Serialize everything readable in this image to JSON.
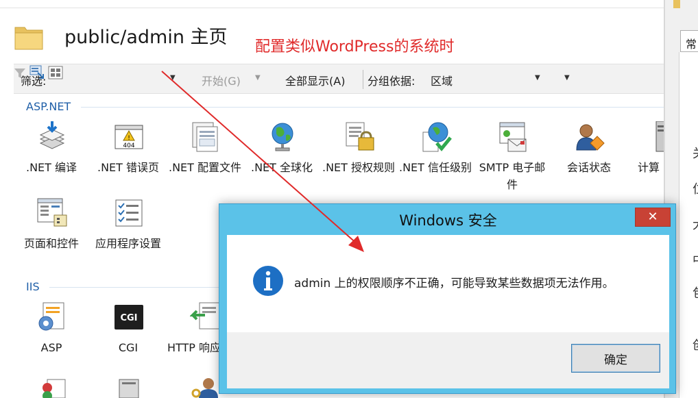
{
  "colors": {
    "group_header": "#1f5fa8",
    "annotation_red": "#e02a2a",
    "dialog_title_bar": "#5bc2e8",
    "dialog_close": "#c84235",
    "info_icon": "#1d6fc4"
  },
  "header": {
    "title": "public/admin 主页",
    "icon": "folder-icon"
  },
  "annotation": {
    "text": "配置类似WordPress的系统时"
  },
  "toolbar": {
    "filter_label": "筛选:",
    "start_label": "开始(G)",
    "show_all_label": "全部显示(A)",
    "group_by_label": "分组依据:",
    "group_by_value": "区域",
    "icons": [
      "funnel-icon",
      "show-all-icon",
      "view-mode-icon"
    ]
  },
  "groups": [
    {
      "name": "ASP.NET",
      "features": [
        {
          "label": ".NET 编译",
          "icon": "net-compilation-icon"
        },
        {
          "label": ".NET 错误页",
          "icon": "net-error-pages-icon"
        },
        {
          "label": ".NET 配置文件",
          "icon": "net-profile-icon"
        },
        {
          "label": ".NET 全球化",
          "icon": "net-globalization-icon"
        },
        {
          "label": ".NET 授权规则",
          "icon": "net-authorization-icon"
        },
        {
          "label": ".NET 信任级别",
          "icon": "net-trust-levels-icon"
        },
        {
          "label": "SMTP 电子邮件",
          "icon": "smtp-email-icon"
        },
        {
          "label": "会话状态",
          "icon": "session-state-icon"
        },
        {
          "label": "计算",
          "icon": "machine-key-icon"
        },
        {
          "label": "页面和控件",
          "icon": "pages-controls-icon"
        },
        {
          "label": "应用程序设置",
          "icon": "app-settings-icon"
        }
      ]
    },
    {
      "name": "IIS",
      "features": [
        {
          "label": "ASP",
          "icon": "asp-icon"
        },
        {
          "label": "CGI",
          "icon": "cgi-icon"
        },
        {
          "label": "HTTP 响应标头",
          "icon": "http-headers-icon"
        }
      ]
    }
  ],
  "right_window": {
    "tab_label": "常",
    "chars": [
      "关",
      "位",
      "大",
      "中",
      "包",
      "创"
    ]
  },
  "dialog": {
    "title": "Windows 安全",
    "close_glyph": "✕",
    "message": "admin 上的权限顺序不正确，可能导致某些数据项无法作用。",
    "ok_label": "确定",
    "icon": "info-icon"
  }
}
